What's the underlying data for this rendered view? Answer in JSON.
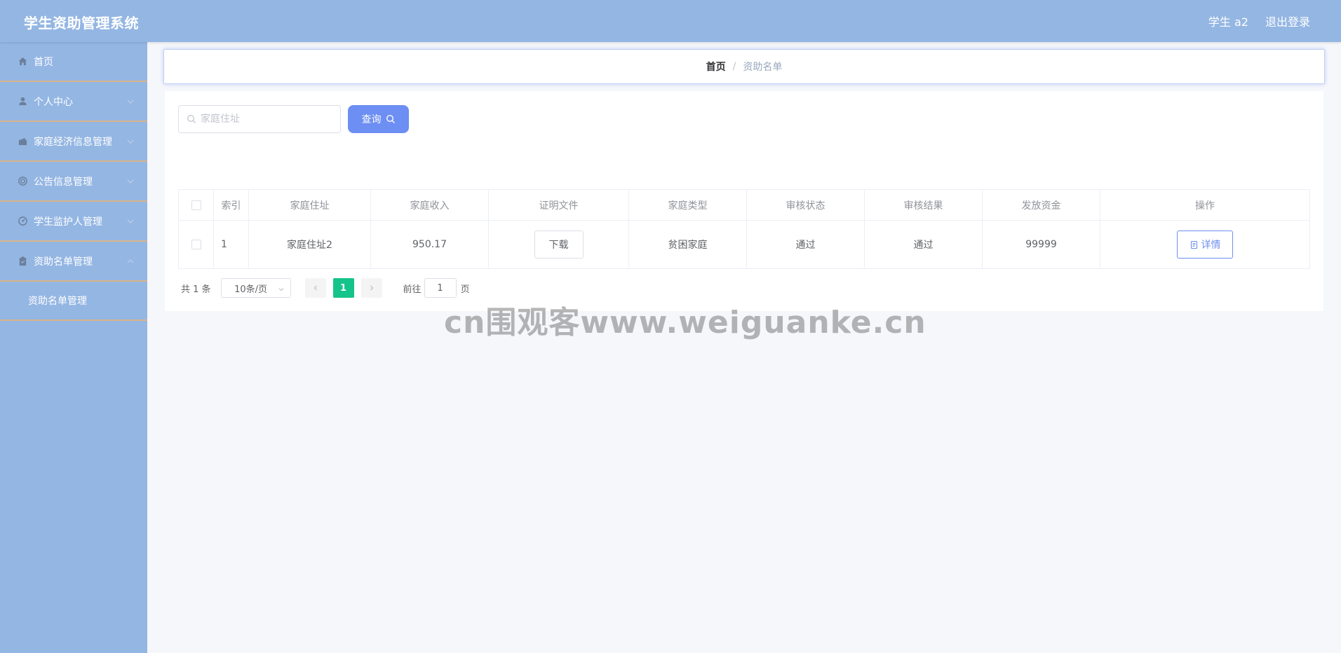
{
  "header": {
    "app_title": "学生资助管理系统",
    "user_label": "学生 a2",
    "logout_label": "退出登录"
  },
  "sidebar": {
    "items": [
      {
        "label": "首页",
        "icon": "home-icon"
      },
      {
        "label": "个人中心",
        "icon": "user-icon"
      },
      {
        "label": "家庭经济信息管理",
        "icon": "wallet-icon"
      },
      {
        "label": "公告信息管理",
        "icon": "target-icon"
      },
      {
        "label": "学生监护人管理",
        "icon": "guardian-icon"
      },
      {
        "label": "资助名单管理",
        "icon": "clipboard-icon"
      }
    ],
    "subitem": "资助名单管理"
  },
  "breadcrumb": {
    "home": "首页",
    "separator": "/",
    "current": "资助名单"
  },
  "search": {
    "placeholder": "家庭住址",
    "button_label": "查询"
  },
  "table": {
    "columns": [
      "索引",
      "家庭住址",
      "家庭收入",
      "证明文件",
      "家庭类型",
      "审核状态",
      "审核结果",
      "发放资金",
      "操作"
    ],
    "rows": [
      {
        "index": "1",
        "address": "家庭住址2",
        "income": "950.17",
        "file_button": "下载",
        "family_type": "贫困家庭",
        "review_status": "通过",
        "review_result": "通过",
        "funds": "99999",
        "action_button": "详情"
      }
    ]
  },
  "pagination": {
    "total": "共 1 条",
    "page_size": "10条/页",
    "current_page": "1",
    "goto_label": "前往",
    "goto_value": "1",
    "page_suffix": "页"
  },
  "watermark": "cn围观客www.weiguanke.cn",
  "colors": {
    "header_bg": "#94b6e3",
    "sidebar_bg": "#94b6e3",
    "accent": "#6d8ef2",
    "active_page": "#15c48b",
    "divider": "#d8b48b"
  }
}
